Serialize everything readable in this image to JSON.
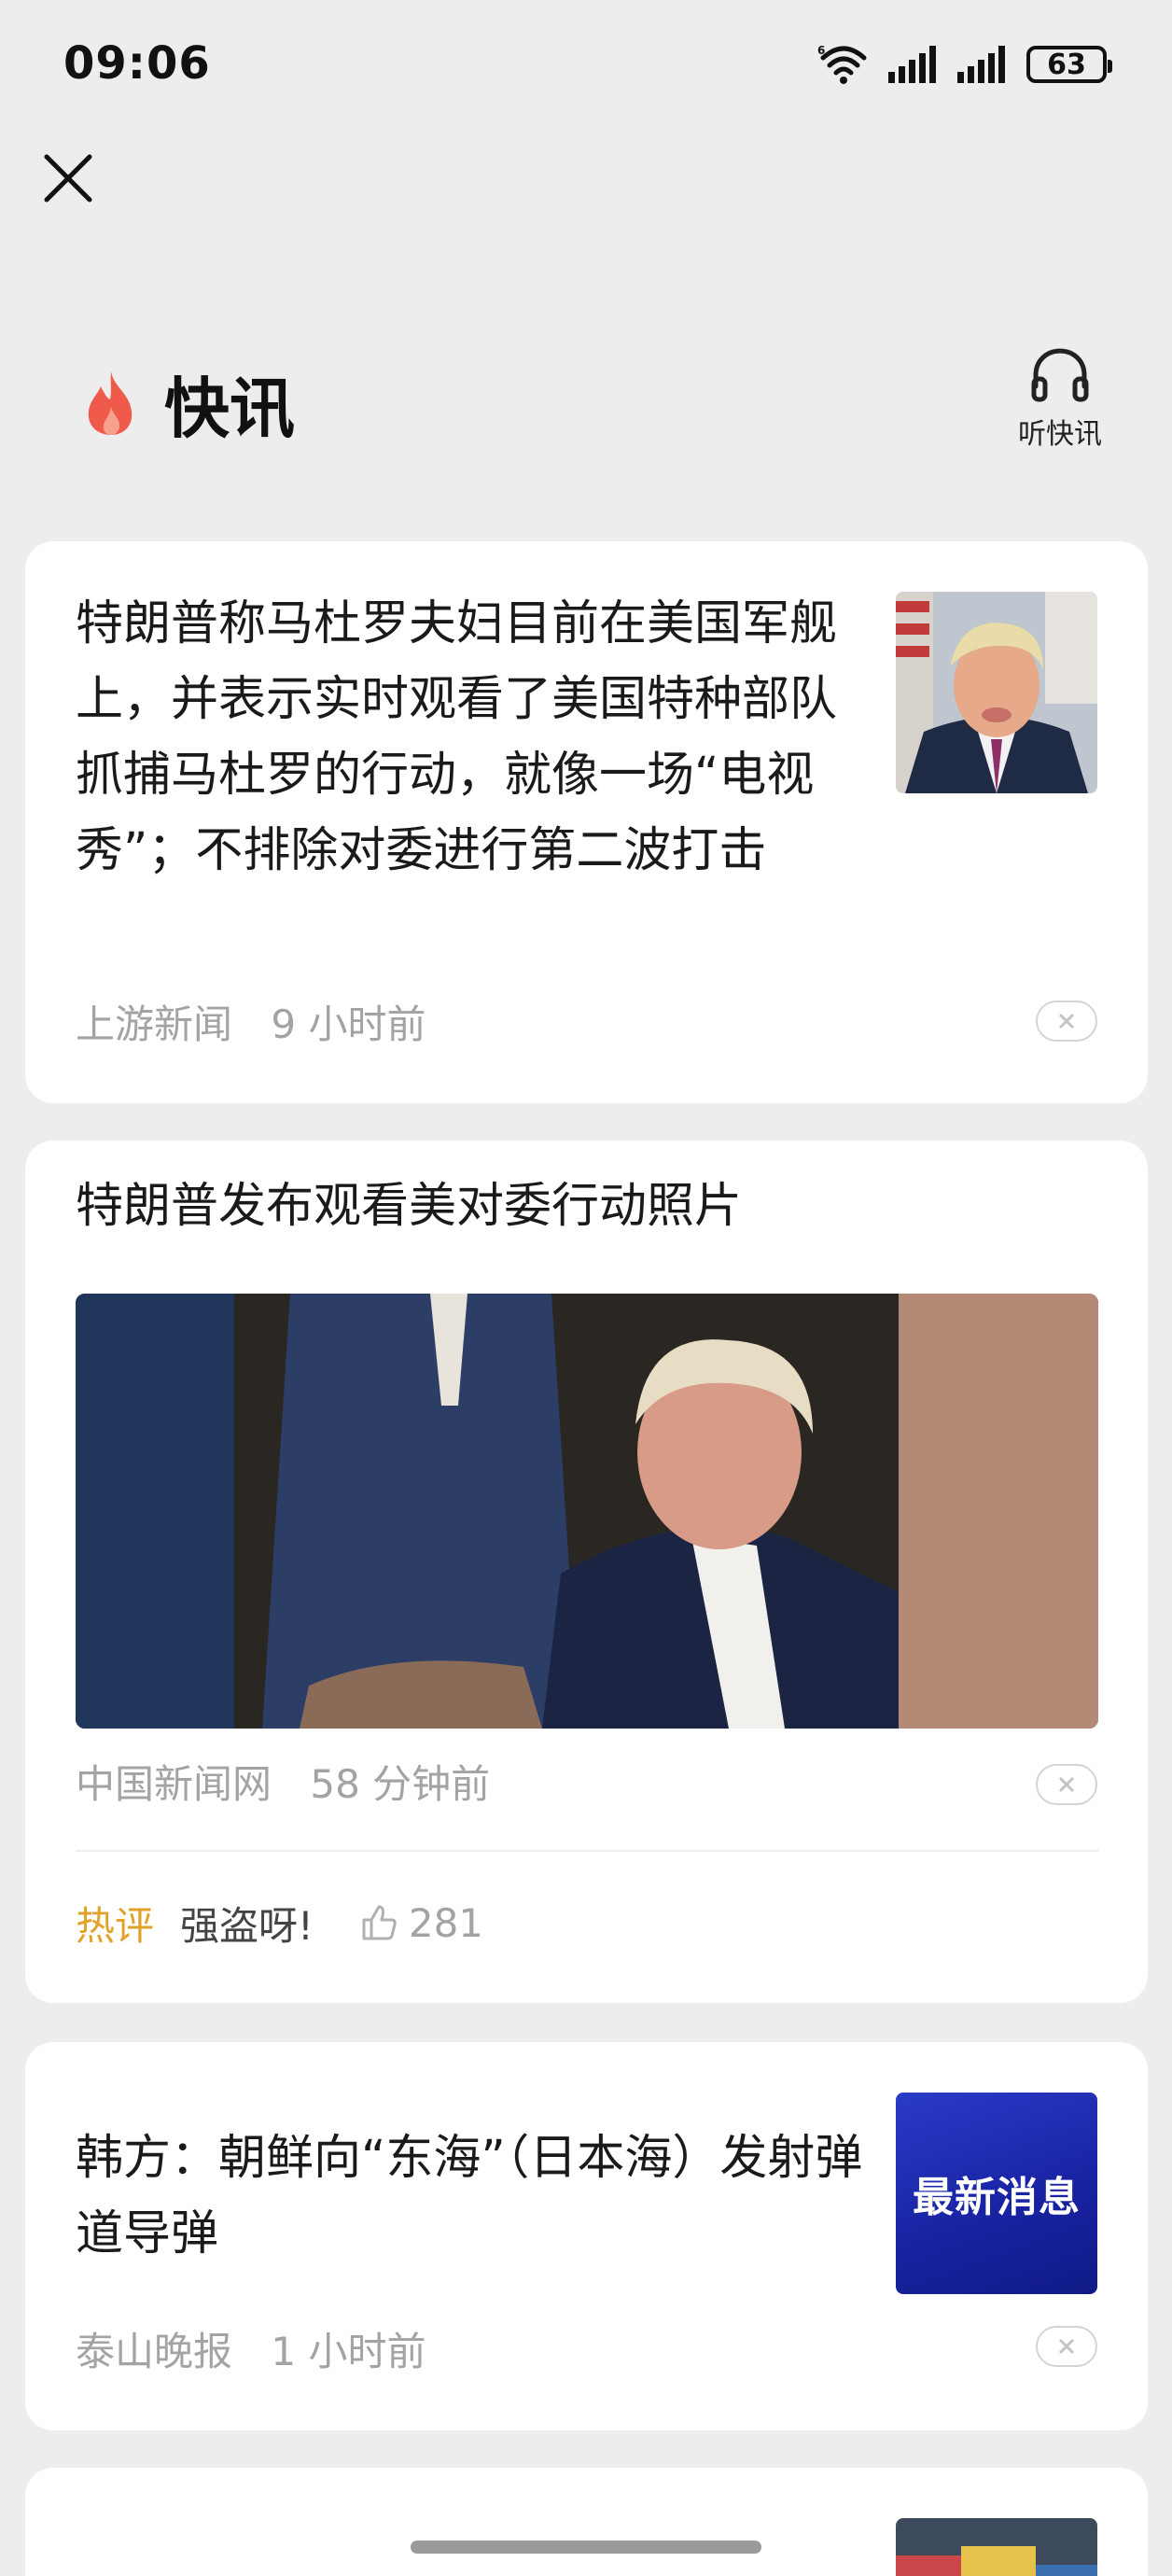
{
  "status_bar": {
    "time": "09:06",
    "battery": "63"
  },
  "header": {
    "title": "快讯",
    "listen_label": "听快讯"
  },
  "cards": [
    {
      "headline": "特朗普称马杜罗夫妇目前在美国军舰上，并表示实时观看了美国特种部队抓捕马杜罗的行动，就像一场“电视秀”；不排除对委进行第二波打击",
      "source": "上游新闻",
      "time": "9 小时前"
    },
    {
      "headline": "特朗普发布观看美对委行动照片",
      "source": "中国新闻网",
      "time": "58 分钟前",
      "hot_tag": "热评",
      "hot_comment": "强盗呀!",
      "likes": "281"
    },
    {
      "headline": "韩方：朝鲜向“东海”（日本海）发射弹道导弹",
      "source": "泰山晚报",
      "time": "1 小时前",
      "thumb_text": "最新消息"
    }
  ],
  "colors": {
    "accent_hot": "#e2a22a",
    "fire": "#f05a4a",
    "badge_blue": "#1722a0"
  }
}
